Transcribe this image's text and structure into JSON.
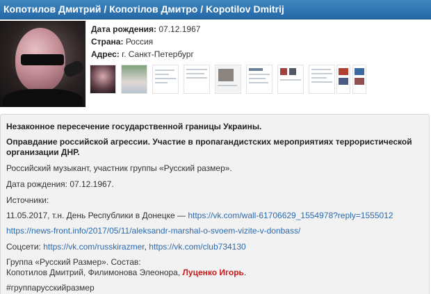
{
  "header": {
    "title": "Копотилов Дмитрий / Копотілов Дмитро / Kopotilov Dmitrij"
  },
  "profile": {
    "birth_label": "Дата рождения:",
    "birth_value": "07.12.1967",
    "country_label": "Страна:",
    "country_value": "Россия",
    "address_label": "Адрес:",
    "address_value": "г. Санкт-Петербург"
  },
  "body": {
    "p1": "Незаконное пересечение государственной границы Украины.",
    "p2_line1": "Оправдание российской агрессии. Участие в пропагандистских мероприятиях террористической",
    "p2_line2": "организации ДНР.",
    "p3": "Российский музыкант, участник группы «Русский размер».",
    "p4": "Дата рождения: 07.12.1967.",
    "p5": "Источники:",
    "p6_text": "11.05.2017, т.н. День Республики  в Донецке — ",
    "p6_link": "https://vk.com/wall-61706629_1554978?reply=1555012",
    "p7_link": "https://news-front.info/2017/05/11/aleksandr-marshal-o-svoem-vizite-v-donbass/",
    "p8_text": "Соцсети: ",
    "p8_link1": "https://vk.com/russkirazmer",
    "p8_sep": ", ",
    "p8_link2": "https://vk.com/club734130",
    "p9_line1": "Группа «Русский Размер». Состав:",
    "p9_line2_text": "Копотилов Дмитрий, Филимонова Элеонора, ",
    "p9_line2_red": "Луценко Игорь",
    "p9_line2_end": ".",
    "p10": "#группарусскийразмер"
  }
}
